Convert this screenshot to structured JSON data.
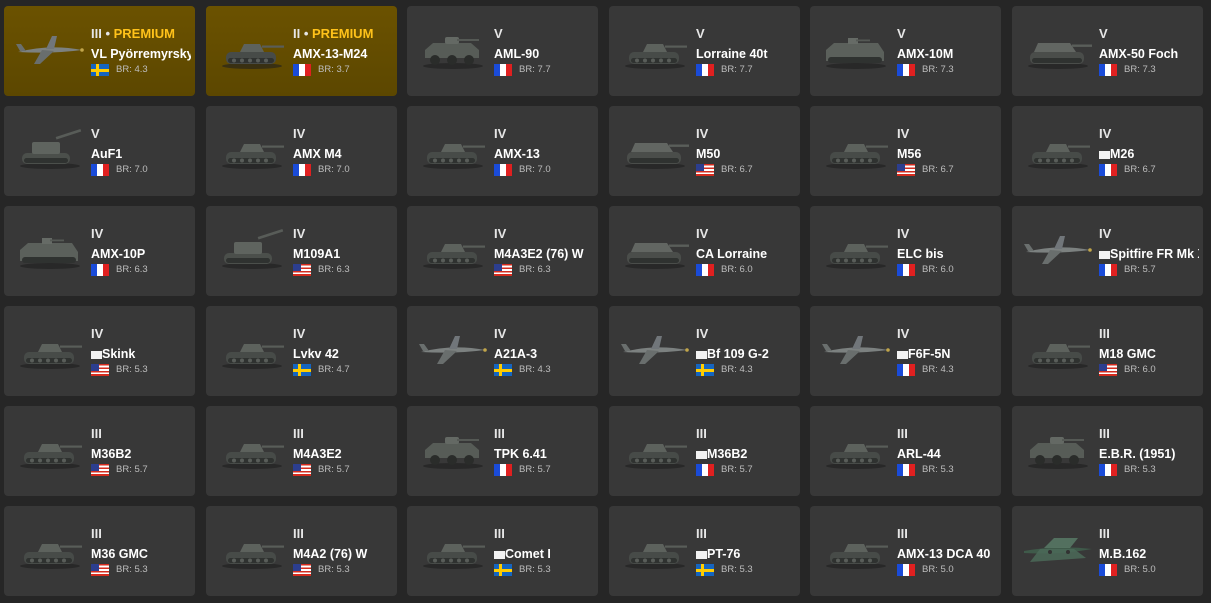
{
  "colors": {
    "background": "#262626",
    "card": "#383838",
    "premium_card": "#5c4700",
    "premium_text": "#ffc21a",
    "text": "#ffffff",
    "br_text": "#bdbdbd"
  },
  "premium_label": "PREMIUM",
  "br_prefix": "BR:",
  "vehicles": [
    {
      "rank": "III",
      "premium": true,
      "name": "VL Pyörremyrsky",
      "nation": "se",
      "br": "4.3",
      "type": "plane",
      "hidden_icon": false
    },
    {
      "rank": "II",
      "premium": true,
      "name": "AMX-13-M24",
      "nation": "fr",
      "br": "3.7",
      "type": "tank",
      "hidden_icon": false
    },
    {
      "rank": "V",
      "premium": false,
      "name": "AML-90",
      "nation": "fr",
      "br": "7.7",
      "type": "wheeled",
      "hidden_icon": false
    },
    {
      "rank": "V",
      "premium": false,
      "name": "Lorraine 40t",
      "nation": "fr",
      "br": "7.7",
      "type": "tank",
      "hidden_icon": false
    },
    {
      "rank": "V",
      "premium": false,
      "name": "AMX-10M",
      "nation": "fr",
      "br": "7.3",
      "type": "ifv",
      "hidden_icon": false
    },
    {
      "rank": "V",
      "premium": false,
      "name": "AMX-50 Foch",
      "nation": "fr",
      "br": "7.3",
      "type": "td",
      "hidden_icon": false
    },
    {
      "rank": "V",
      "premium": false,
      "name": "AuF1",
      "nation": "fr",
      "br": "7.0",
      "type": "spg",
      "hidden_icon": false
    },
    {
      "rank": "IV",
      "premium": false,
      "name": "AMX M4",
      "nation": "fr",
      "br": "7.0",
      "type": "tank",
      "hidden_icon": false
    },
    {
      "rank": "IV",
      "premium": false,
      "name": "AMX-13",
      "nation": "fr",
      "br": "7.0",
      "type": "tank",
      "hidden_icon": false
    },
    {
      "rank": "IV",
      "premium": false,
      "name": "M50",
      "nation": "us",
      "br": "6.7",
      "type": "td",
      "hidden_icon": false
    },
    {
      "rank": "IV",
      "premium": false,
      "name": "M56",
      "nation": "us",
      "br": "6.7",
      "type": "tank",
      "hidden_icon": false
    },
    {
      "rank": "IV",
      "premium": false,
      "name": "M26",
      "nation": "fr",
      "br": "6.7",
      "type": "tank",
      "hidden_icon": true
    },
    {
      "rank": "IV",
      "premium": false,
      "name": "AMX-10P",
      "nation": "fr",
      "br": "6.3",
      "type": "ifv",
      "hidden_icon": false
    },
    {
      "rank": "IV",
      "premium": false,
      "name": "M109A1",
      "nation": "us",
      "br": "6.3",
      "type": "spg",
      "hidden_icon": false
    },
    {
      "rank": "IV",
      "premium": false,
      "name": "M4A3E2 (76) W",
      "nation": "us",
      "br": "6.3",
      "type": "tank",
      "hidden_icon": false
    },
    {
      "rank": "IV",
      "premium": false,
      "name": "CA Lorraine",
      "nation": "fr",
      "br": "6.0",
      "type": "td",
      "hidden_icon": false
    },
    {
      "rank": "IV",
      "premium": false,
      "name": "ELC bis",
      "nation": "fr",
      "br": "6.0",
      "type": "tank",
      "hidden_icon": false
    },
    {
      "rank": "IV",
      "premium": false,
      "name": "Spitfire FR Mk XI",
      "nation": "fr",
      "br": "5.7",
      "type": "plane",
      "hidden_icon": true
    },
    {
      "rank": "IV",
      "premium": false,
      "name": "Skink",
      "nation": "us",
      "br": "5.3",
      "type": "tank",
      "hidden_icon": true
    },
    {
      "rank": "IV",
      "premium": false,
      "name": "Lvkv 42",
      "nation": "se",
      "br": "4.7",
      "type": "tank",
      "hidden_icon": false
    },
    {
      "rank": "IV",
      "premium": false,
      "name": "A21A-3",
      "nation": "se",
      "br": "4.3",
      "type": "plane",
      "hidden_icon": false
    },
    {
      "rank": "IV",
      "premium": false,
      "name": "Bf 109 G-2",
      "nation": "se",
      "br": "4.3",
      "type": "plane",
      "hidden_icon": true
    },
    {
      "rank": "IV",
      "premium": false,
      "name": "F6F-5N",
      "nation": "fr",
      "br": "4.3",
      "type": "plane",
      "hidden_icon": true
    },
    {
      "rank": "III",
      "premium": false,
      "name": "M18 GMC",
      "nation": "us",
      "br": "6.0",
      "type": "tank",
      "hidden_icon": false
    },
    {
      "rank": "III",
      "premium": false,
      "name": "M36B2",
      "nation": "us",
      "br": "5.7",
      "type": "tank",
      "hidden_icon": false
    },
    {
      "rank": "III",
      "premium": false,
      "name": "M4A3E2",
      "nation": "us",
      "br": "5.7",
      "type": "tank",
      "hidden_icon": false
    },
    {
      "rank": "III",
      "premium": false,
      "name": "TPK 6.41",
      "nation": "fr",
      "br": "5.7",
      "type": "wheeled",
      "hidden_icon": false
    },
    {
      "rank": "III",
      "premium": false,
      "name": "M36B2",
      "nation": "fr",
      "br": "5.7",
      "type": "tank",
      "hidden_icon": true
    },
    {
      "rank": "III",
      "premium": false,
      "name": "ARL-44",
      "nation": "fr",
      "br": "5.3",
      "type": "tank",
      "hidden_icon": false
    },
    {
      "rank": "III",
      "premium": false,
      "name": "E.B.R. (1951)",
      "nation": "fr",
      "br": "5.3",
      "type": "wheeled",
      "hidden_icon": false
    },
    {
      "rank": "III",
      "premium": false,
      "name": "M36 GMC",
      "nation": "us",
      "br": "5.3",
      "type": "tank",
      "hidden_icon": false
    },
    {
      "rank": "III",
      "premium": false,
      "name": "M4A2 (76) W",
      "nation": "us",
      "br": "5.3",
      "type": "tank",
      "hidden_icon": false
    },
    {
      "rank": "III",
      "premium": false,
      "name": "Comet I",
      "nation": "se",
      "br": "5.3",
      "type": "tank",
      "hidden_icon": true
    },
    {
      "rank": "III",
      "premium": false,
      "name": "PT-76",
      "nation": "se",
      "br": "5.3",
      "type": "tank",
      "hidden_icon": true
    },
    {
      "rank": "III",
      "premium": false,
      "name": "AMX-13 DCA 40",
      "nation": "fr",
      "br": "5.0",
      "type": "tank",
      "hidden_icon": false
    },
    {
      "rank": "III",
      "premium": false,
      "name": "M.B.162",
      "nation": "fr",
      "br": "5.0",
      "type": "bomber",
      "hidden_icon": false
    }
  ]
}
